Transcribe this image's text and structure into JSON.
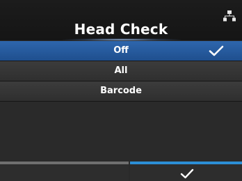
{
  "header": {
    "title": "Head Check",
    "status_icon": "network-icon"
  },
  "options": [
    {
      "label": "Off",
      "selected": true
    },
    {
      "label": "All",
      "selected": false
    },
    {
      "label": "Barcode",
      "selected": false
    }
  ],
  "footer": {
    "left_button_icon": "",
    "right_button_icon": "check-icon"
  },
  "colors": {
    "selected_row": "#2a5fa3",
    "accent_bar": "#2c8fd6",
    "background": "#2a2a2a"
  }
}
